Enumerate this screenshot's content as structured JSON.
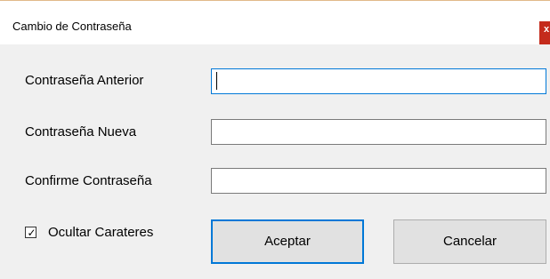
{
  "window": {
    "title": "Cambio de Contraseña",
    "close_glyph": "x",
    "accent_color": "#0078d7",
    "close_color": "#c42b1c"
  },
  "form": {
    "old_password_label": "Contraseña Anterior",
    "old_password_value": "",
    "new_password_label": "Contraseña Nueva",
    "new_password_value": "",
    "confirm_password_label": "Confirme Contraseña",
    "confirm_password_value": "",
    "hide_chars_label": "Ocultar Carateres",
    "hide_chars_checked": true,
    "hide_chars_check_glyph": "✓"
  },
  "buttons": {
    "accept_label": "Aceptar",
    "cancel_label": "Cancelar"
  }
}
